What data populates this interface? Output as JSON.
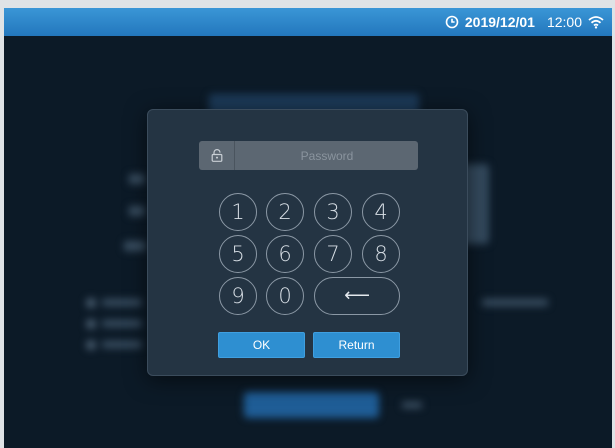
{
  "status_bar": {
    "date": "2019/12/01",
    "time": "12:00",
    "clock_icon": "clock-icon",
    "wifi_icon": "wifi-icon"
  },
  "dialog": {
    "password_placeholder": "Password",
    "password_value": "",
    "lock_icon": "unlock-icon",
    "keys": [
      "1",
      "2",
      "3",
      "4",
      "5",
      "6",
      "7",
      "8",
      "9",
      "0"
    ],
    "backspace_symbol": "⟵",
    "ok_label": "OK",
    "return_label": "Return"
  },
  "colors": {
    "accent": "#2e8fd1",
    "status_bar": "#2a80c5",
    "background": "#0c1a27",
    "dialog": "#243443"
  }
}
